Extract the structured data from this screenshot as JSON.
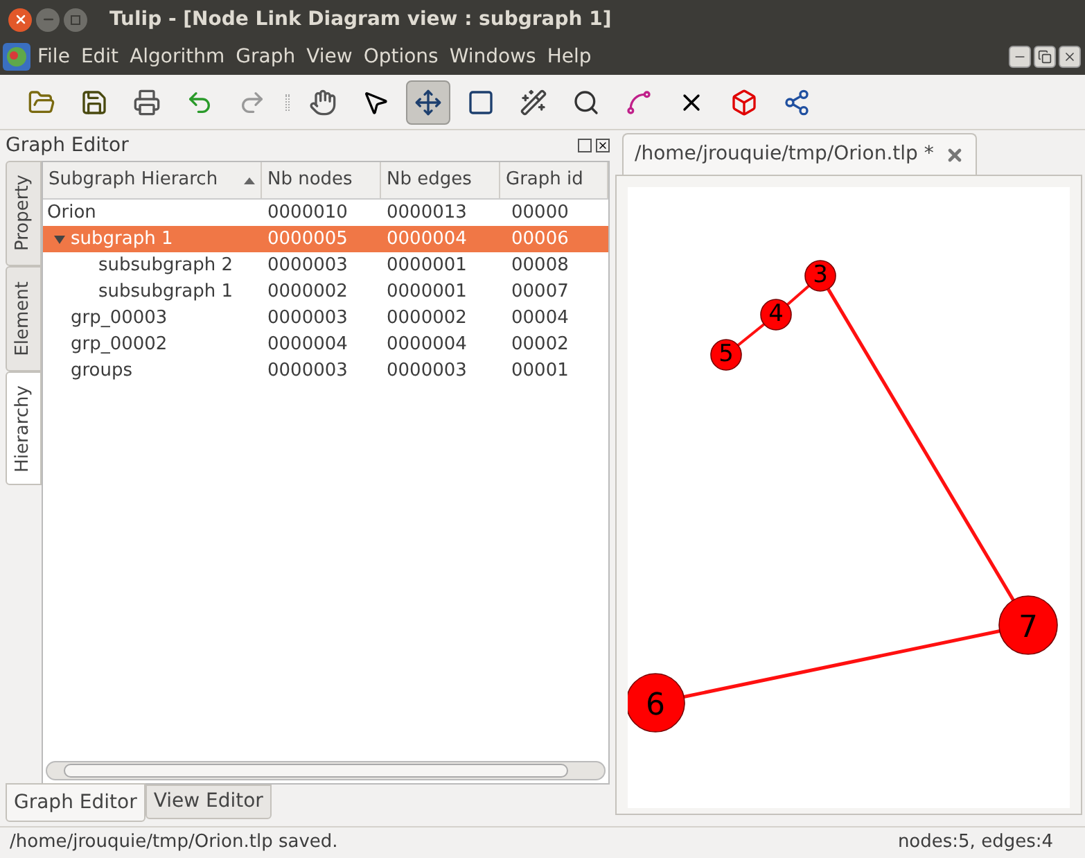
{
  "window": {
    "title": "Tulip - [Node Link Diagram view : subgraph 1]"
  },
  "menu": [
    "File",
    "Edit",
    "Algorithm",
    "Graph",
    "View",
    "Options",
    "Windows",
    "Help"
  ],
  "toolbar": [
    {
      "kind": "open",
      "selected": false
    },
    {
      "kind": "save",
      "selected": false
    },
    {
      "kind": "print",
      "selected": false
    },
    {
      "kind": "undo",
      "selected": false
    },
    {
      "kind": "redo",
      "selected": false
    },
    {
      "kind": "separator"
    },
    {
      "kind": "hand",
      "selected": false
    },
    {
      "kind": "help",
      "selected": false
    },
    {
      "kind": "move",
      "selected": true
    },
    {
      "kind": "rect",
      "selected": false
    },
    {
      "kind": "wand",
      "selected": false
    },
    {
      "kind": "zoom",
      "selected": false
    },
    {
      "kind": "curve",
      "selected": false
    },
    {
      "kind": "delete",
      "selected": false
    },
    {
      "kind": "cube",
      "selected": false
    },
    {
      "kind": "graph",
      "selected": false
    }
  ],
  "dock": {
    "title": "Graph Editor",
    "side_tabs": [
      {
        "label": "Property",
        "selected": false
      },
      {
        "label": "Element",
        "selected": false
      },
      {
        "label": "Hierarchy",
        "selected": true
      }
    ],
    "columns": [
      "Subgraph Hierarch",
      "Nb nodes",
      "Nb edges",
      "Graph id"
    ],
    "rows": [
      {
        "name": "Orion",
        "nodes": "0000010",
        "edges": "0000013",
        "id": "00000",
        "selected": false,
        "children": [
          {
            "name": "subgraph 1",
            "nodes": "0000005",
            "edges": "0000004",
            "id": "00006",
            "selected": true,
            "expanded": true,
            "children": [
              {
                "name": "subsubgraph 2",
                "nodes": "0000003",
                "edges": "0000001",
                "id": "00008",
                "selected": false
              },
              {
                "name": "subsubgraph 1",
                "nodes": "0000002",
                "edges": "0000001",
                "id": "00007",
                "selected": false
              }
            ]
          },
          {
            "name": "grp_00003",
            "nodes": "0000003",
            "edges": "0000002",
            "id": "00004",
            "selected": false
          },
          {
            "name": "grp_00002",
            "nodes": "0000004",
            "edges": "0000004",
            "id": "00002",
            "selected": false
          },
          {
            "name": "groups",
            "nodes": "0000003",
            "edges": "0000003",
            "id": "00001",
            "selected": false
          }
        ]
      }
    ],
    "bottom_tabs": [
      {
        "label": "Graph Editor",
        "selected": true
      },
      {
        "label": "View Editor",
        "selected": false
      }
    ]
  },
  "view": {
    "tab": "/home/jrouquie/tmp/Orion.tlp *",
    "nodes": [
      {
        "label": "3"
      },
      {
        "label": "4"
      },
      {
        "label": "5"
      },
      {
        "label": "7"
      },
      {
        "label": "6"
      }
    ]
  },
  "status_bar": {
    "message": "/home/jrouquie/tmp/Orion.tlp saved.",
    "counts": "nodes:5, edges:4"
  }
}
